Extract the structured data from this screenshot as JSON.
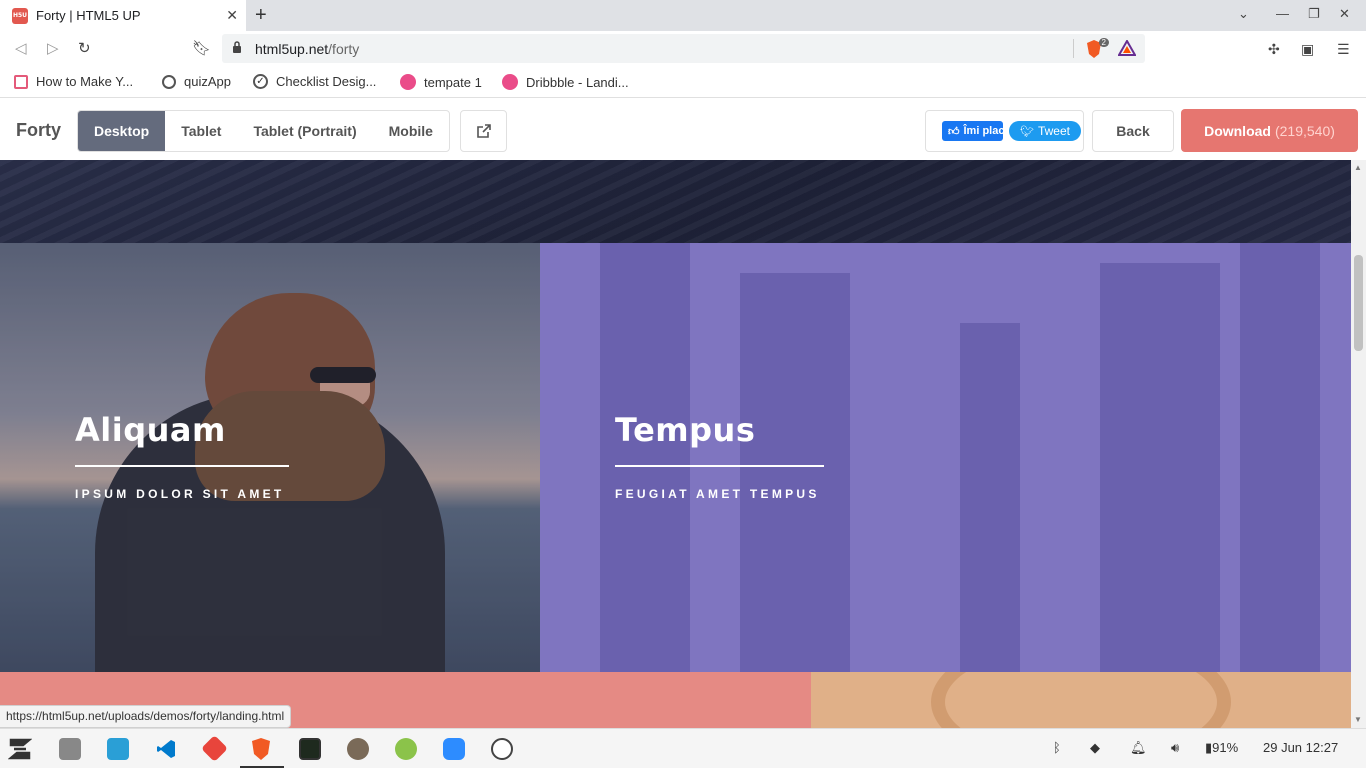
{
  "browser": {
    "tab": {
      "title": "Forty | HTML5 UP",
      "favicon_text": "H5U"
    },
    "url": {
      "host": "html5up.net",
      "path": "/forty"
    },
    "shield_count": "2",
    "bookmarks": [
      {
        "label": "How to Make Y...",
        "color": "#e45a7a"
      },
      {
        "label": "quizApp",
        "color": "#555555"
      },
      {
        "label": "Checklist Desig...",
        "color": "#555555"
      },
      {
        "label": "tempate 1",
        "color": "#ea4c89"
      },
      {
        "label": "Dribbble - Landi...",
        "color": "#ea4c89"
      }
    ]
  },
  "demobar": {
    "brand": "Forty",
    "viewports": [
      "Desktop",
      "Tablet",
      "Tablet (Portrait)",
      "Mobile"
    ],
    "active_viewport": "Desktop",
    "fb_like": "Îmi place",
    "tweet": "Tweet",
    "back": "Back",
    "download": "Download",
    "download_count": "(219,540)"
  },
  "tiles": [
    {
      "title": "Aliquam",
      "subtitle": "IPSUM DOLOR SIT AMET",
      "color": "#5c6478"
    },
    {
      "title": "Tempus",
      "subtitle": "FEUGIAT AMET TEMPUS",
      "color": "#7f75c0"
    },
    {
      "title": "",
      "subtitle": "",
      "color": "#e58a84"
    },
    {
      "title": "",
      "subtitle": "",
      "color": "#e0b088"
    }
  ],
  "status_url": "https://html5up.net/uploads/demos/forty/landing.html",
  "taskbar": {
    "battery": "91%",
    "datetime": "29 Jun 12:27"
  },
  "colors": {
    "accent": "#e67670",
    "active_viewport_bg": "#646b7d",
    "page_bg": "#242943"
  }
}
